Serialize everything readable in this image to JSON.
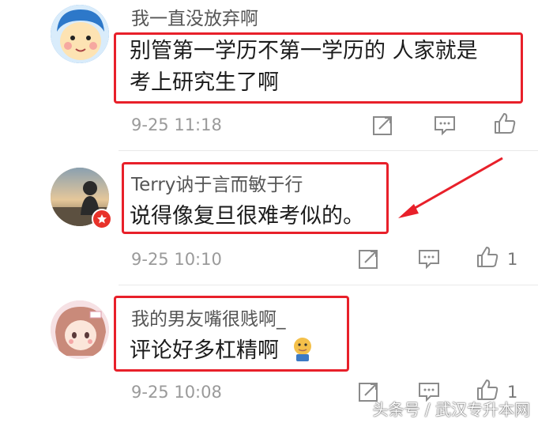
{
  "comments": [
    {
      "username": "我一直没放弃啊",
      "lines": [
        "别管第一学历不第一学历的 人家就是",
        "考上研究生了啊"
      ],
      "time": "9-25 11:18",
      "likes": ""
    },
    {
      "username": "Terry讷于言而敏于行",
      "lines": [
        "说得像复旦很难考似的。"
      ],
      "time": "9-25 10:10",
      "likes": "1"
    },
    {
      "username": "我的男友嘴很贱啊_",
      "lines": [
        "评论好多杠精啊"
      ],
      "time": "9-25 10:08",
      "likes": "1"
    }
  ],
  "watermark": "头条号 / 武汉专升本网",
  "colors": {
    "highlight_box": "#e8202a",
    "meta_text": "#9a9a9a"
  },
  "icons": [
    "share-icon",
    "comment-icon",
    "like-icon",
    "emoji-icon",
    "vip-badge-icon"
  ]
}
